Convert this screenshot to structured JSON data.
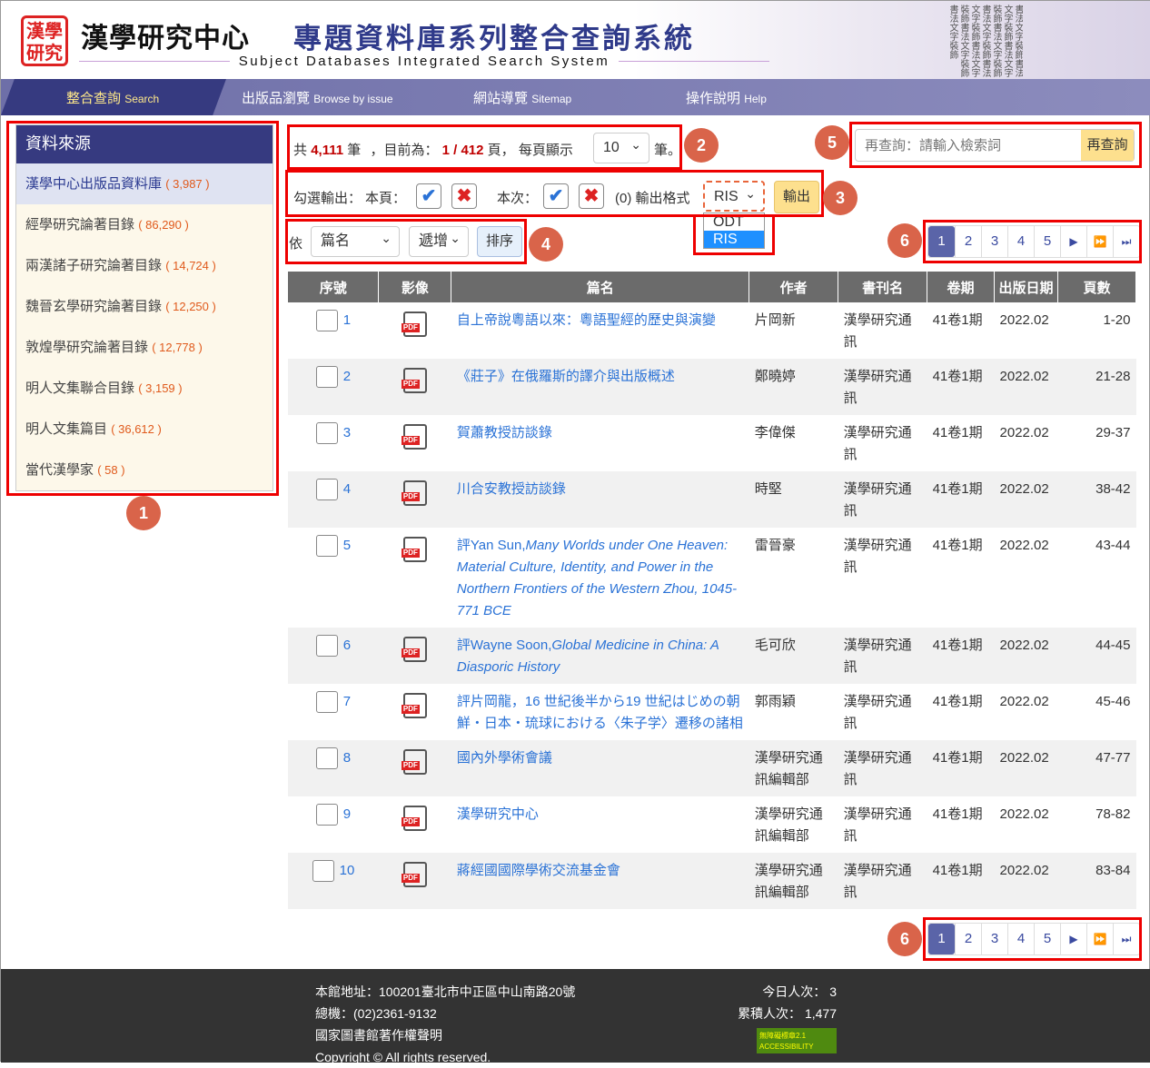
{
  "header": {
    "seal_text": "漢學研究",
    "title_cn": "漢學研究中心",
    "title_system": "專題資料庫系列整合查詢系統",
    "subtitle": "Subject Databases Integrated Search System"
  },
  "nav": [
    {
      "cn": "整合查詢",
      "en": "Search",
      "active": true
    },
    {
      "cn": "出版品瀏覽",
      "en": "Browse by issue"
    },
    {
      "cn": "網站導覽",
      "en": "Sitemap"
    },
    {
      "cn": "操作說明",
      "en": "Help"
    }
  ],
  "sidebar": {
    "title": "資料來源",
    "items": [
      {
        "label": "漢學中心出版品資料庫",
        "count": "( 3,987 )",
        "active": true
      },
      {
        "label": "經學研究論著目錄",
        "count": "( 86,290 )"
      },
      {
        "label": "兩漢諸子研究論著目錄",
        "count": "( 14,724 )"
      },
      {
        "label": "魏晉玄學研究論著目錄",
        "count": "( 12,250 )"
      },
      {
        "label": "敦煌學研究論著目錄",
        "count": "( 12,778 )"
      },
      {
        "label": "明人文集聯合目錄",
        "count": "( 3,159 )"
      },
      {
        "label": "明人文集篇目",
        "count": "( 36,612 )"
      },
      {
        "label": "當代漢學家",
        "count": "( 58 )"
      }
    ]
  },
  "summary": {
    "pre": "共",
    "total": "4,111",
    "unit": "筆",
    "current_label": "，目前為：",
    "page": "1 / 412",
    "page_unit": "頁，",
    "per_page_label": "每頁顯示",
    "per_page": "10",
    "suffix": "筆。"
  },
  "export": {
    "label": "勾選輸出：",
    "this_page": "本頁：",
    "this_time": "本次：",
    "count": "(0)",
    "format_label": "輸出格式",
    "format": "RIS",
    "options": [
      "ODT",
      "RIS"
    ],
    "button": "輸出"
  },
  "sort": {
    "label": "依",
    "field": "篇名",
    "order": "遞增",
    "button": "排序"
  },
  "research": {
    "placeholder": "再查詢：請輸入檢索詞",
    "button": "再查詢"
  },
  "pager": {
    "pages": [
      "1",
      "2",
      "3",
      "4",
      "5"
    ],
    "current": "1",
    "next": "▶",
    "fast_forward": "⏩",
    "last": "⏭"
  },
  "table": {
    "headers": [
      "序號",
      "影像",
      "篇名",
      "作者",
      "書刊名",
      "卷期",
      "出版日期",
      "頁數"
    ],
    "rows": [
      {
        "no": "1",
        "title": "自上帝說粵語以來：粵語聖經的歷史與演變",
        "author": "片岡新",
        "journal": "漢學研究通訊",
        "vol": "41卷1期",
        "date": "2022.02",
        "pages": "1-20"
      },
      {
        "no": "2",
        "title": "《莊子》在俄羅斯的譯介與出版概述",
        "author": "鄭曉婷",
        "journal": "漢學研究通訊",
        "vol": "41卷1期",
        "date": "2022.02",
        "pages": "21-28"
      },
      {
        "no": "3",
        "title": "賀蕭教授訪談錄",
        "author": "李偉傑",
        "journal": "漢學研究通訊",
        "vol": "41卷1期",
        "date": "2022.02",
        "pages": "29-37"
      },
      {
        "no": "4",
        "title": "川合安教授訪談錄",
        "author": "時堅",
        "journal": "漢學研究通訊",
        "vol": "41卷1期",
        "date": "2022.02",
        "pages": "38-42"
      },
      {
        "no": "5",
        "title": "評Yan Sun,",
        "title_italic": "Many Worlds under One Heaven: Material Culture, Identity, and Power in the Northern Frontiers of the Western Zhou, 1045-771 BCE",
        "author": "雷晉豪",
        "journal": "漢學研究通訊",
        "vol": "41卷1期",
        "date": "2022.02",
        "pages": "43-44"
      },
      {
        "no": "6",
        "title": "評Wayne Soon,",
        "title_italic": "Global Medicine in China: A Diasporic History",
        "author": "毛可欣",
        "journal": "漢學研究通訊",
        "vol": "41卷1期",
        "date": "2022.02",
        "pages": "44-45"
      },
      {
        "no": "7",
        "title": "評片岡龍，16 世紀後半から19 世紀はじめの朝 鮮・日本・琉球における〈朱子学〉遷移の諸相",
        "author": "郭雨穎",
        "journal": "漢學研究通訊",
        "vol": "41卷1期",
        "date": "2022.02",
        "pages": "45-46"
      },
      {
        "no": "8",
        "title": "國內外學術會議",
        "author": "漢學研究通訊編輯部",
        "journal": "漢學研究通訊",
        "vol": "41卷1期",
        "date": "2022.02",
        "pages": "47-77"
      },
      {
        "no": "9",
        "title": "漢學研究中心",
        "author": "漢學研究通訊編輯部",
        "journal": "漢學研究通訊",
        "vol": "41卷1期",
        "date": "2022.02",
        "pages": "78-82"
      },
      {
        "no": "10",
        "title": "蔣經國國際學術交流基金會",
        "author": "漢學研究通訊編輯部",
        "journal": "漢學研究通訊",
        "vol": "41卷1期",
        "date": "2022.02",
        "pages": "83-84"
      }
    ]
  },
  "footer": {
    "address": "本館地址：100201臺北市中正區中山南路20號",
    "phone": "總機：(02)2361-9132",
    "copyright_notice": "國家圖書館著作權聲明",
    "copyright": "Copyright © All rights reserved.",
    "today": "今日人次： 3",
    "total": "累積人次： 1,477",
    "badge": "無障礙標章2.1 ACCESSIBILITY"
  },
  "annotations": [
    "1",
    "2",
    "3",
    "4",
    "5",
    "6",
    "6"
  ],
  "colors": {
    "nav_active": "#363a80",
    "nav": "#7a7ab3",
    "accent_red": "#c00000",
    "link": "#2a72d6",
    "annotation": "#d9644a",
    "box": "#e00000"
  }
}
